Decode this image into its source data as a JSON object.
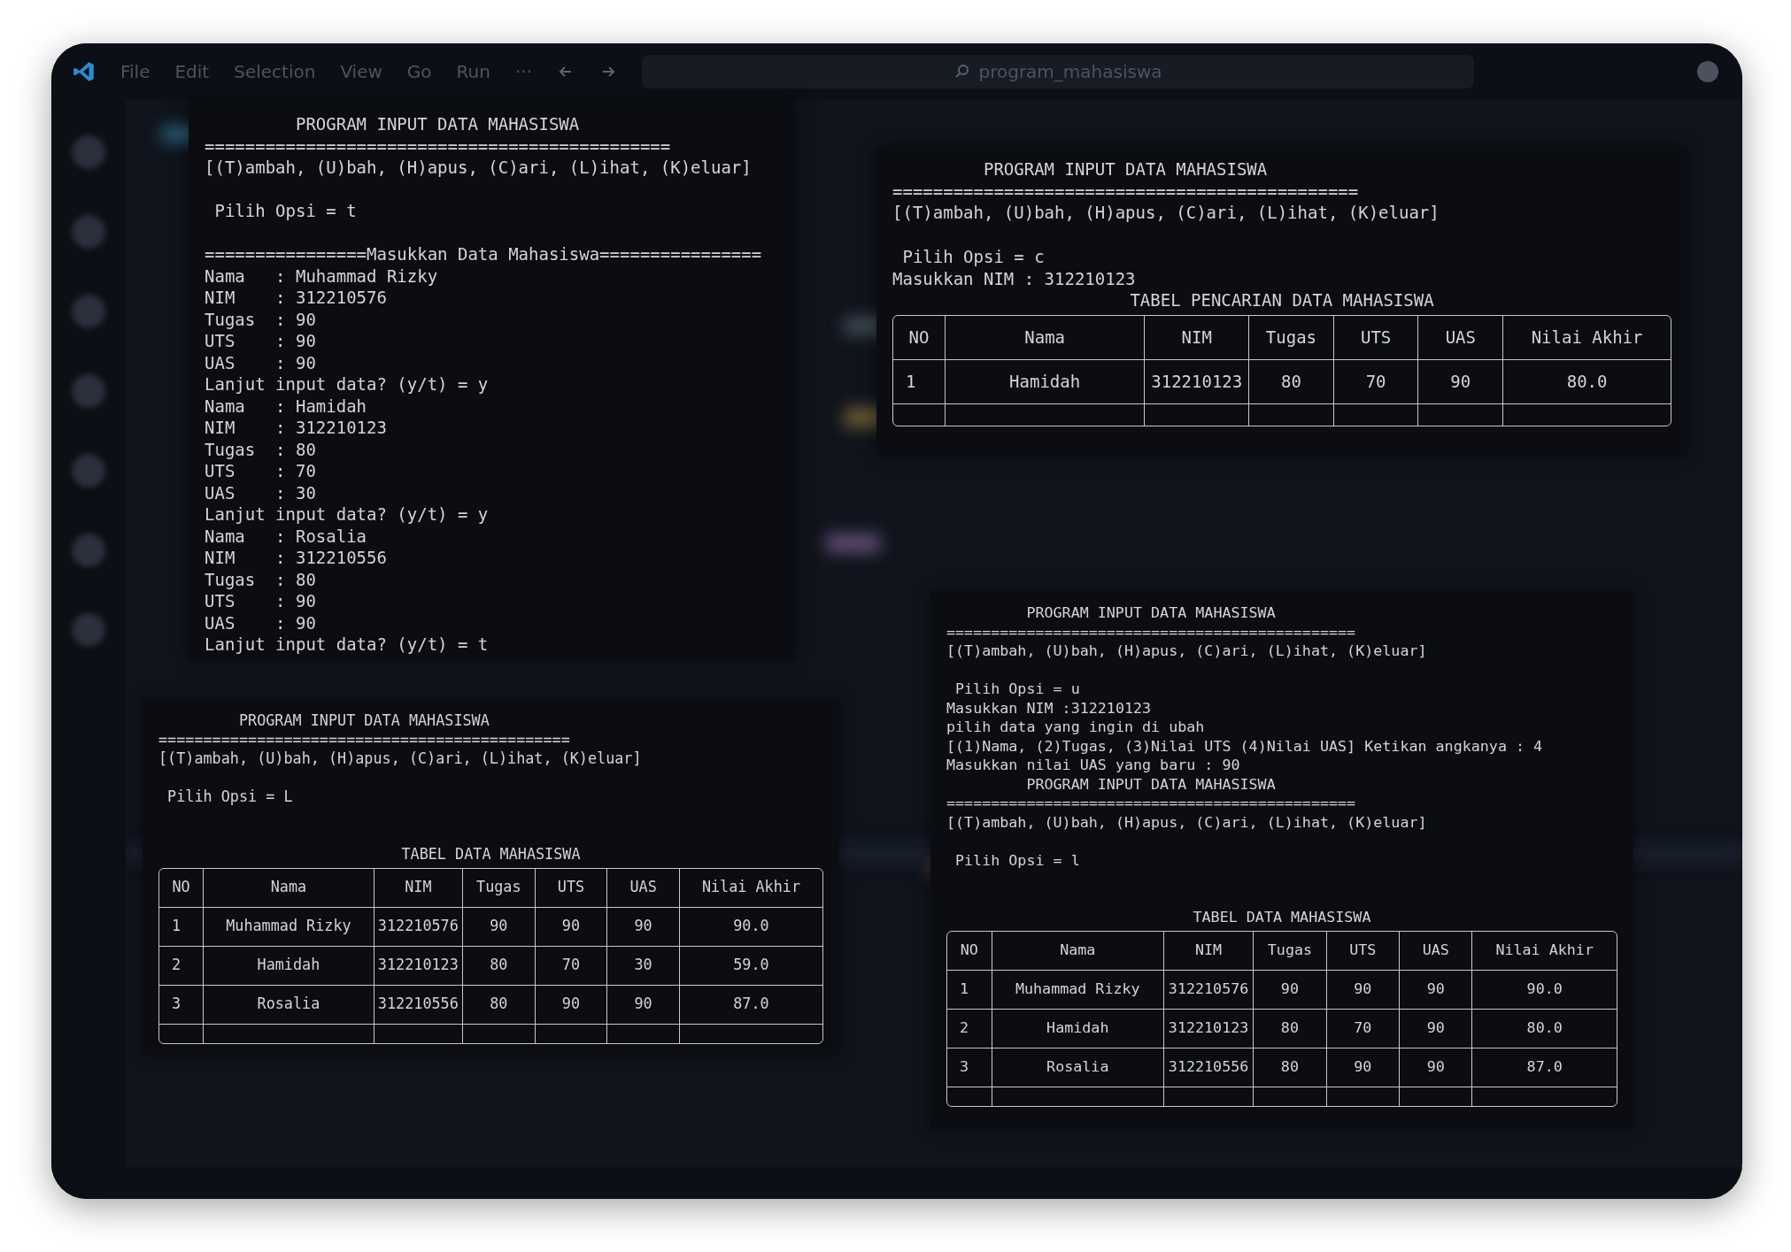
{
  "editor": {
    "menu": [
      "File",
      "Edit",
      "Selection",
      "View",
      "Go",
      "Run",
      "···"
    ],
    "search": "program_mahasiswa"
  },
  "terminals": [
    {
      "lines": [
        {
          "kind": "title",
          "text": "PROGRAM INPUT DATA MAHASISWA"
        },
        {
          "kind": "line",
          "text": "=============================================="
        },
        {
          "kind": "line",
          "text": "[(T)ambah, (U)bah, (H)apus, (C)ari, (L)ihat, (K)eluar]"
        },
        {
          "kind": "blank"
        },
        {
          "kind": "prompt",
          "text": "Pilih Opsi = t"
        },
        {
          "kind": "blank"
        },
        {
          "kind": "line",
          "text": "================Masukkan Data Mahasiswa================"
        },
        {
          "kind": "line",
          "text": "Nama   : Muhammad Rizky"
        },
        {
          "kind": "line",
          "text": "NIM    : 312210576"
        },
        {
          "kind": "line",
          "text": "Tugas  : 90"
        },
        {
          "kind": "line",
          "text": "UTS    : 90"
        },
        {
          "kind": "line",
          "text": "UAS    : 90"
        },
        {
          "kind": "line",
          "text": "Lanjut input data? (y/t) = y"
        },
        {
          "kind": "line",
          "text": "Nama   : Hamidah"
        },
        {
          "kind": "line",
          "text": "NIM    : 312210123"
        },
        {
          "kind": "line",
          "text": "Tugas  : 80"
        },
        {
          "kind": "line",
          "text": "UTS    : 70"
        },
        {
          "kind": "line",
          "text": "UAS    : 30"
        },
        {
          "kind": "line",
          "text": "Lanjut input data? (y/t) = y"
        },
        {
          "kind": "line",
          "text": "Nama   : Rosalia"
        },
        {
          "kind": "line",
          "text": "NIM    : 312210556"
        },
        {
          "kind": "line",
          "text": "Tugas  : 80"
        },
        {
          "kind": "line",
          "text": "UTS    : 90"
        },
        {
          "kind": "line",
          "text": "UAS    : 90"
        },
        {
          "kind": "line",
          "text": "Lanjut input data? (y/t) = t"
        }
      ]
    },
    {
      "lines": [
        {
          "kind": "title",
          "text": "PROGRAM INPUT DATA MAHASISWA"
        },
        {
          "kind": "line",
          "text": "=============================================="
        },
        {
          "kind": "line",
          "text": "[(T)ambah, (U)bah, (H)apus, (C)ari, (L)ihat, (K)eluar]"
        },
        {
          "kind": "blank"
        },
        {
          "kind": "prompt",
          "text": "Pilih Opsi = c"
        },
        {
          "kind": "line",
          "text": "Masukkan NIM : 312210123"
        }
      ],
      "table": {
        "title": "TABEL PENCARIAN DATA MAHASISWA",
        "columns": [
          "NO",
          "Nama",
          "NIM",
          "Tugas",
          "UTS",
          "UAS",
          "Nilai Akhir"
        ],
        "rows": [
          [
            "1",
            "Hamidah",
            "312210123",
            "80",
            "70",
            "90",
            "80.0"
          ]
        ]
      }
    },
    {
      "lines": [
        {
          "kind": "title",
          "text": "PROGRAM INPUT DATA MAHASISWA"
        },
        {
          "kind": "line",
          "text": "=============================================="
        },
        {
          "kind": "line",
          "text": "[(T)ambah, (U)bah, (H)apus, (C)ari, (L)ihat, (K)eluar]"
        },
        {
          "kind": "blank"
        },
        {
          "kind": "prompt",
          "text": "Pilih Opsi = L"
        },
        {
          "kind": "blank"
        },
        {
          "kind": "blank"
        }
      ],
      "table": {
        "title": "TABEL DATA MAHASISWA",
        "columns": [
          "NO",
          "Nama",
          "NIM",
          "Tugas",
          "UTS",
          "UAS",
          "Nilai Akhir"
        ],
        "rows": [
          [
            "1",
            "Muhammad Rizky",
            "312210576",
            "90",
            "90",
            "90",
            "90.0"
          ],
          [
            "2",
            "Hamidah",
            "312210123",
            "80",
            "70",
            "30",
            "59.0"
          ],
          [
            "3",
            "Rosalia",
            "312210556",
            "80",
            "90",
            "90",
            "87.0"
          ]
        ]
      }
    },
    {
      "lines": [
        {
          "kind": "title",
          "text": "PROGRAM INPUT DATA MAHASISWA"
        },
        {
          "kind": "line",
          "text": "=============================================="
        },
        {
          "kind": "line",
          "text": "[(T)ambah, (U)bah, (H)apus, (C)ari, (L)ihat, (K)eluar]"
        },
        {
          "kind": "blank"
        },
        {
          "kind": "prompt",
          "text": "Pilih Opsi = u"
        },
        {
          "kind": "line",
          "text": "Masukkan NIM :312210123"
        },
        {
          "kind": "line",
          "text": "pilih data yang ingin di ubah"
        },
        {
          "kind": "line",
          "text": "[(1)Nama, (2)Tugas, (3)Nilai UTS (4)Nilai UAS] Ketikan angkanya : 4"
        },
        {
          "kind": "line",
          "text": "Masukkan nilai UAS yang baru : 90"
        },
        {
          "kind": "title",
          "text": "PROGRAM INPUT DATA MAHASISWA"
        },
        {
          "kind": "line",
          "text": "=============================================="
        },
        {
          "kind": "line",
          "text": "[(T)ambah, (U)bah, (H)apus, (C)ari, (L)ihat, (K)eluar]"
        },
        {
          "kind": "blank"
        },
        {
          "kind": "prompt",
          "text": "Pilih Opsi = l"
        },
        {
          "kind": "blank"
        },
        {
          "kind": "blank"
        }
      ],
      "table": {
        "title": "TABEL DATA MAHASISWA",
        "columns": [
          "NO",
          "Nama",
          "NIM",
          "Tugas",
          "UTS",
          "UAS",
          "Nilai Akhir"
        ],
        "rows": [
          [
            "1",
            "Muhammad Rizky",
            "312210576",
            "90",
            "90",
            "90",
            "90.0"
          ],
          [
            "2",
            "Hamidah",
            "312210123",
            "80",
            "70",
            "90",
            "80.0"
          ],
          [
            "3",
            "Rosalia",
            "312210556",
            "80",
            "90",
            "90",
            "87.0"
          ]
        ]
      }
    }
  ]
}
